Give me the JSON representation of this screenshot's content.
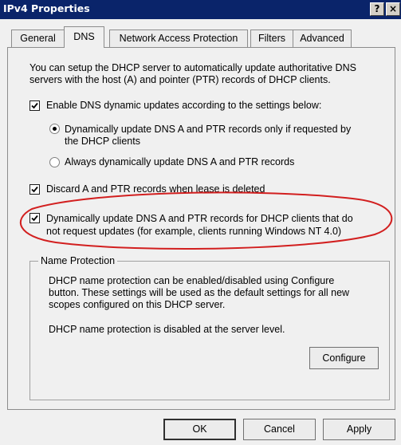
{
  "window": {
    "title": "IPv4 Properties",
    "help_label": "?",
    "close_label": "×"
  },
  "tabs": [
    {
      "label": "General",
      "active": false
    },
    {
      "label": "DNS",
      "active": true
    },
    {
      "label": "Network Access Protection",
      "active": false
    },
    {
      "label": "Filters",
      "active": false
    },
    {
      "label": "Advanced",
      "active": false
    }
  ],
  "dns": {
    "intro_line1": "You can setup the DHCP server to automatically update authoritative DNS",
    "intro_line2": "servers with the host (A) and pointer (PTR) records of DHCP clients.",
    "enable_updates": {
      "checked": true,
      "label": "Enable DNS dynamic updates according to the settings below:"
    },
    "radio_requested": {
      "selected": true,
      "line1": "Dynamically update DNS A and PTR records only if requested by",
      "line2": "the DHCP clients"
    },
    "radio_always": {
      "selected": false,
      "label": "Always dynamically update DNS A and PTR records"
    },
    "discard_records": {
      "checked": true,
      "label": "Discard A and PTR records when lease is deleted"
    },
    "update_nt4": {
      "checked": true,
      "line1": "Dynamically update DNS A and PTR records for DHCP clients that do",
      "line2": "not request updates (for example, clients running Windows NT 4.0)"
    },
    "name_protection": {
      "legend": "Name Protection",
      "desc_line1": "DHCP name protection can be enabled/disabled using Configure",
      "desc_line2": "button. These settings will be used as the default settings for all new",
      "desc_line3": "scopes configured on this DHCP server.",
      "status": "DHCP name protection is disabled at the server level.",
      "configure_label": "Configure"
    }
  },
  "buttons": {
    "ok": "OK",
    "cancel": "Cancel",
    "apply": "Apply"
  },
  "colors": {
    "titlebar": "#0a246a",
    "annotation": "#d21f1f"
  }
}
